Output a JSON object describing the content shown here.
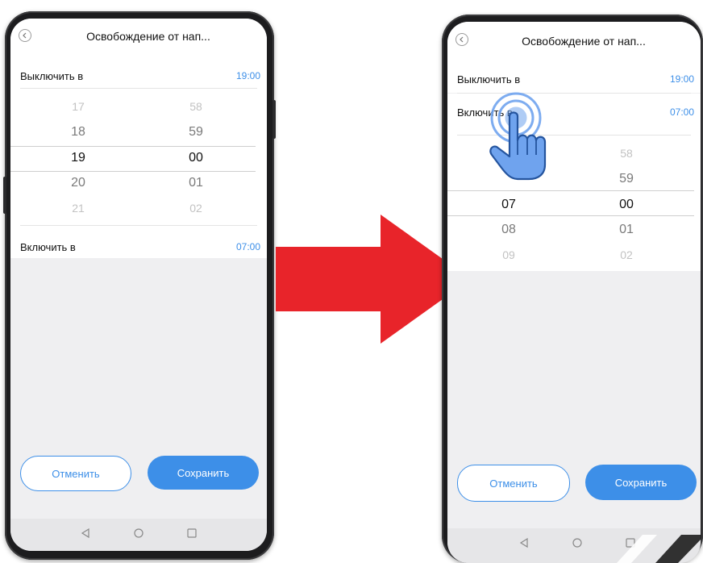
{
  "left_phone": {
    "header": {
      "title": "Освобождение от нап..."
    },
    "off_row": {
      "label": "Выключить в",
      "value": "19:00"
    },
    "picker": {
      "hours": [
        "17",
        "18",
        "19",
        "20",
        "21"
      ],
      "minutes": [
        "58",
        "59",
        "00",
        "01",
        "02"
      ]
    },
    "on_row": {
      "label": "Включить в",
      "value": "07:00"
    },
    "buttons": {
      "cancel": "Отменить",
      "save": "Сохранить"
    }
  },
  "right_phone": {
    "header": {
      "title": "Освобождение от нап..."
    },
    "off_row": {
      "label": "Выключить в",
      "value": "19:00"
    },
    "on_row": {
      "label": "Включить в",
      "value": "07:00"
    },
    "picker": {
      "hours": [
        "07",
        "08",
        "09"
      ],
      "minutes": [
        "58",
        "59",
        "00",
        "01",
        "02"
      ]
    },
    "buttons": {
      "cancel": "Отменить",
      "save": "Сохранить"
    }
  },
  "colors": {
    "accent": "#3d8fe8",
    "arrow": "#e8242a",
    "hand": "#6fa3ee"
  },
  "icons": [
    "back-icon",
    "nav-back-icon",
    "nav-home-icon",
    "nav-recent-icon",
    "tap-hand-icon",
    "arrow-right-icon"
  ]
}
